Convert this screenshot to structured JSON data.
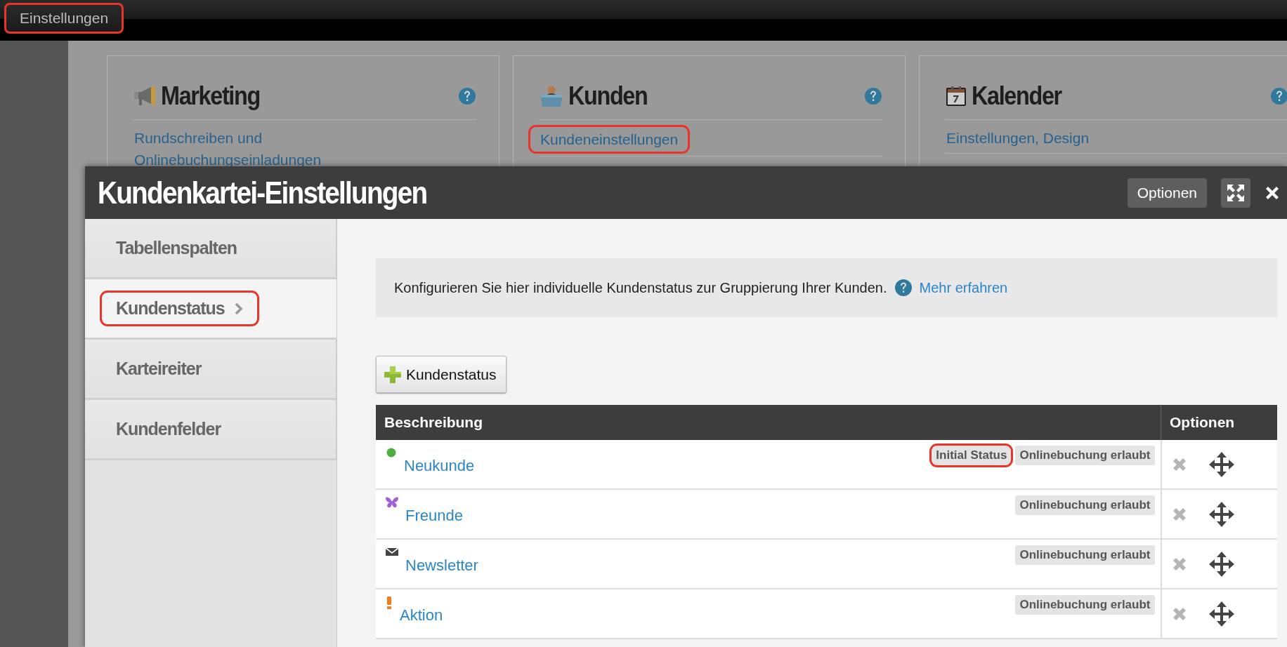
{
  "top_bar": {
    "button": "Einstellungen",
    "highlighted": true
  },
  "cards": [
    {
      "kind": "megaphone",
      "title": "Marketing",
      "links": [
        {
          "text": "Rundschreiben und Onlinebuchungseinladungen",
          "highlighted": false
        }
      ]
    },
    {
      "kind": "person",
      "title": "Kunden",
      "links": [
        {
          "text": "Kundeneinstellungen",
          "highlighted": true
        }
      ]
    },
    {
      "kind": "calendar",
      "title": "Kalender",
      "links": [
        {
          "text": "Einstellungen, Design",
          "highlighted": false
        }
      ]
    }
  ],
  "dialog": {
    "title": "Kundenkartei-Einstellungen",
    "options_button": "Optionen",
    "sidebar": [
      {
        "label": "Tabellenspalten",
        "selected": false,
        "highlighted": false
      },
      {
        "label": "Kundenstatus",
        "selected": true,
        "highlighted": true
      },
      {
        "label": "Karteireiter",
        "selected": false,
        "highlighted": false
      },
      {
        "label": "Kundenfelder",
        "selected": false,
        "highlighted": false
      }
    ],
    "info": {
      "text": "Konfigurieren Sie hier individuelle Kundenstatus zur Gruppierung Ihrer Kunden.",
      "link": "Mehr erfahren"
    },
    "add_button": "Kundenstatus",
    "table": {
      "columns": [
        "Beschreibung",
        "Optionen"
      ],
      "rows": [
        {
          "kind": "dot",
          "color": "#4caf3e",
          "name": "Neukunde",
          "badges": [
            {
              "text": "Initial Status",
              "highlighted": true
            },
            {
              "text": "Onlinebuchung erlaubt",
              "highlighted": false
            }
          ]
        },
        {
          "kind": "butterfly",
          "color": "#a25fd6",
          "name": "Freunde",
          "badges": [
            {
              "text": "Onlinebuchung erlaubt",
              "highlighted": false
            }
          ]
        },
        {
          "kind": "envelope",
          "color": "#444444",
          "name": "Newsletter",
          "badges": [
            {
              "text": "Onlinebuchung erlaubt",
              "highlighted": false
            }
          ]
        },
        {
          "kind": "exclamation",
          "color": "#f07c1e",
          "name": "Aktion",
          "badges": [
            {
              "text": "Onlinebuchung erlaubt",
              "highlighted": false
            }
          ]
        }
      ]
    }
  }
}
